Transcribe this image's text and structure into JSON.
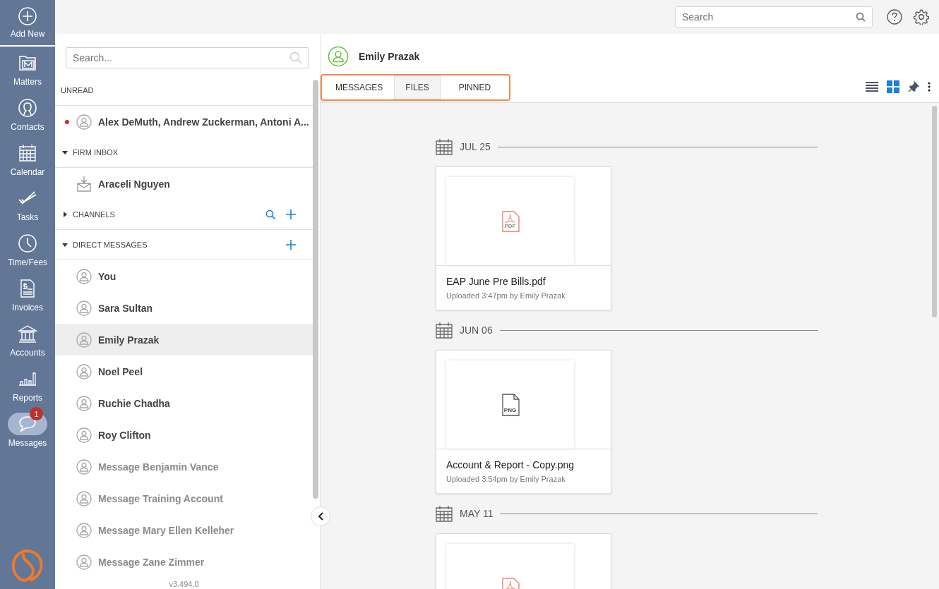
{
  "nav": {
    "add_new": "Add New",
    "items": [
      {
        "kind": "matters",
        "label": "Matters",
        "selected": false
      },
      {
        "kind": "contacts",
        "label": "Contacts",
        "selected": false
      },
      {
        "kind": "calendar",
        "label": "Calendar",
        "selected": false
      },
      {
        "kind": "tasks",
        "label": "Tasks",
        "selected": false
      },
      {
        "kind": "time",
        "label": "Time/Fees",
        "selected": false
      },
      {
        "kind": "invoices",
        "label": "Invoices",
        "selected": false
      },
      {
        "kind": "accounts",
        "label": "Accounts",
        "selected": false
      },
      {
        "kind": "reports",
        "label": "Reports",
        "selected": false
      },
      {
        "kind": "messages",
        "label": "Messages",
        "selected": true,
        "badge": "1"
      }
    ]
  },
  "top_search": {
    "placeholder": "Search"
  },
  "sidebar": {
    "search": {
      "placeholder": "Search..."
    },
    "sections": [
      {
        "title": "UNREAD",
        "items": [
          {
            "kind": "person",
            "name": "Alex DeMuth, Andrew Zuckerman, Antoni A...",
            "unread": true,
            "muted": false,
            "selected": false
          }
        ]
      },
      {
        "title": "FIRM INBOX",
        "expanded": true,
        "items": [
          {
            "kind": "inbox",
            "name": "Araceli Nguyen",
            "unread": false,
            "muted": false,
            "selected": false
          }
        ]
      },
      {
        "title": "CHANNELS",
        "expanded": false,
        "search": true,
        "add": true
      },
      {
        "title": "DIRECT MESSAGES",
        "expanded": true,
        "add": true,
        "items": [
          {
            "kind": "person",
            "name": "You",
            "unread": false,
            "muted": false,
            "selected": false
          },
          {
            "kind": "person",
            "name": "Sara Sultan",
            "unread": false,
            "muted": false,
            "selected": false
          },
          {
            "kind": "person",
            "name": "Emily Prazak",
            "unread": false,
            "muted": false,
            "selected": true
          },
          {
            "kind": "person",
            "name": "Noel Peel",
            "unread": false,
            "muted": false,
            "selected": false
          },
          {
            "kind": "person",
            "name": "Ruchie Chadha",
            "unread": false,
            "muted": false,
            "selected": false
          },
          {
            "kind": "person",
            "name": "Roy Clifton",
            "unread": false,
            "muted": false,
            "selected": false
          },
          {
            "kind": "person",
            "name": "Message Benjamin Vance",
            "unread": false,
            "muted": true,
            "selected": false
          },
          {
            "kind": "person",
            "name": "Message Training Account",
            "unread": false,
            "muted": true,
            "selected": false
          },
          {
            "kind": "person",
            "name": "Message Mary Ellen Kelleher",
            "unread": false,
            "muted": true,
            "selected": false
          },
          {
            "kind": "person",
            "name": "Message Zane Zimmer",
            "unread": false,
            "muted": true,
            "selected": false
          }
        ]
      }
    ],
    "version": "v3.494.0"
  },
  "conversation": {
    "name": "Emily Prazak",
    "tabs": [
      {
        "label": "MESSAGES",
        "selected": false
      },
      {
        "label": "FILES",
        "selected": true
      },
      {
        "label": "PINNED",
        "selected": false
      }
    ],
    "view_modes": [
      {
        "kind": "list",
        "selected": false
      },
      {
        "kind": "grid",
        "selected": true
      }
    ],
    "groups": [
      {
        "date": "JUL 25",
        "files": [
          {
            "kind": "pdf",
            "type_label": "PDF",
            "name": "EAP June Pre Bills.pdf",
            "meta": "Uploaded 3:47pm by Emily Prazak"
          }
        ]
      },
      {
        "date": "JUN 06",
        "files": [
          {
            "kind": "png",
            "type_label": "PNG",
            "name": "Account & Report - Copy.png",
            "meta": "Uploaded 3:54pm by Emily Prazak"
          }
        ]
      },
      {
        "date": "MAY 11",
        "files": [
          {
            "kind": "pdf"
          }
        ]
      }
    ]
  }
}
